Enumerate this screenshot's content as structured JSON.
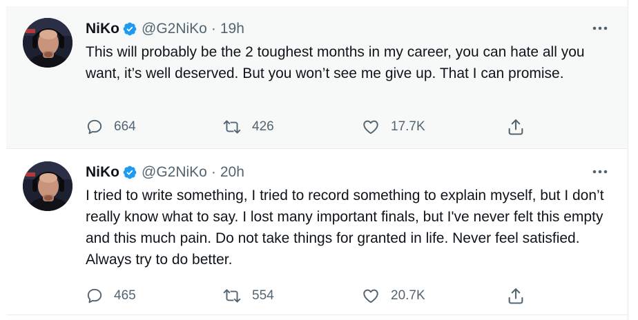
{
  "tweets": [
    {
      "author_name": "NiKo",
      "handle": "@G2NiKo",
      "separator": "·",
      "time": "19h",
      "text": "This will probably be the 2 toughest months in my career, you can hate all you want, it’s well deserved. But you won’t see me give up. That I can promise.",
      "reply_count": "664",
      "retweet_count": "426",
      "like_count": "17.7K"
    },
    {
      "author_name": "NiKo",
      "handle": "@G2NiKo",
      "separator": "·",
      "time": "20h",
      "text": "I tried to write something, I tried to record something to explain myself, but I don’t really know what to say. I lost many important finals, but I've never felt this empty and this much pain. Do not take things for granted in life. Never feel satisfied. Always try to do better.",
      "reply_count": "465",
      "retweet_count": "554",
      "like_count": "20.7K"
    }
  ],
  "icons": {
    "verified": "verified-badge-icon",
    "more": "more-horizontal-icon",
    "reply": "reply-icon",
    "retweet": "retweet-icon",
    "like": "heart-icon",
    "share": "share-icon"
  },
  "colors": {
    "verified": "#1d9bf0",
    "secondary_text": "#536471",
    "primary_text": "#0f1419",
    "hover_background": "#f7f9f9"
  }
}
